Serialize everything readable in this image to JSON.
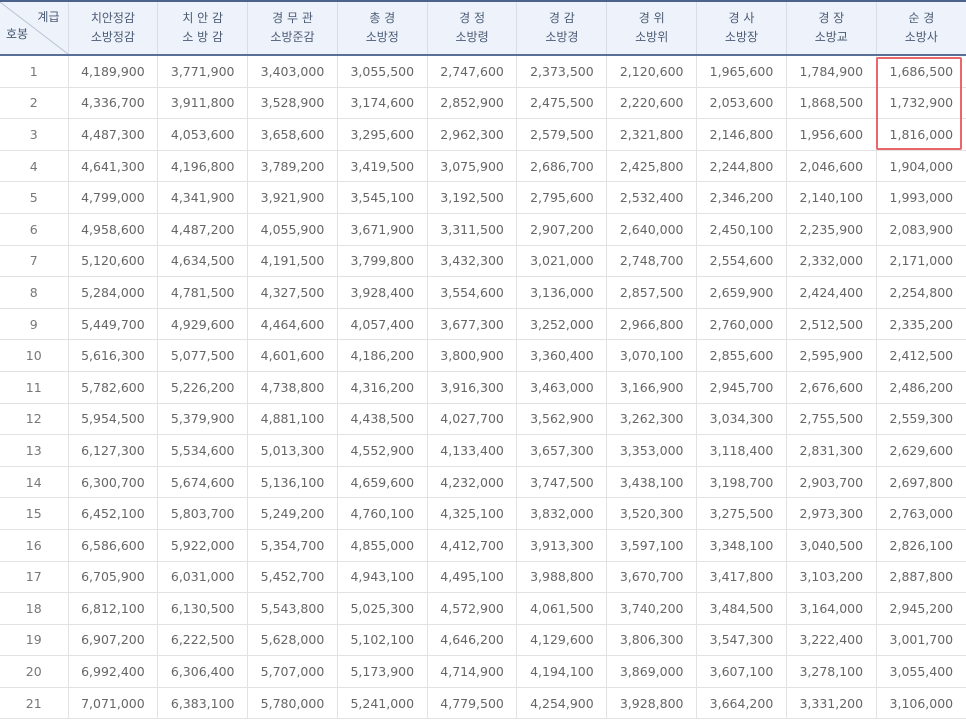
{
  "corner": {
    "top": "계급",
    "bottom": "호봉"
  },
  "columns": [
    {
      "line1": "치안정감",
      "line2": "소방정감"
    },
    {
      "line1": "치 안 감",
      "line2": "소 방 감"
    },
    {
      "line1": "경 무 관",
      "line2": "소방준감"
    },
    {
      "line1": "총 경",
      "line2": "소방정"
    },
    {
      "line1": "경 정",
      "line2": "소방령"
    },
    {
      "line1": "경 감",
      "line2": "소방경"
    },
    {
      "line1": "경 위",
      "line2": "소방위"
    },
    {
      "line1": "경 사",
      "line2": "소방장"
    },
    {
      "line1": "경 장",
      "line2": "소방교"
    },
    {
      "line1": "순 경",
      "line2": "소방사"
    }
  ],
  "rows": [
    {
      "step": "1",
      "values": [
        "4,189,900",
        "3,771,900",
        "3,403,000",
        "3,055,500",
        "2,747,600",
        "2,373,500",
        "2,120,600",
        "1,965,600",
        "1,784,900",
        "1,686,500"
      ]
    },
    {
      "step": "2",
      "values": [
        "4,336,700",
        "3,911,800",
        "3,528,900",
        "3,174,600",
        "2,852,900",
        "2,475,500",
        "2,220,600",
        "2,053,600",
        "1,868,500",
        "1,732,900"
      ]
    },
    {
      "step": "3",
      "values": [
        "4,487,300",
        "4,053,600",
        "3,658,600",
        "3,295,600",
        "2,962,300",
        "2,579,500",
        "2,321,800",
        "2,146,800",
        "1,956,600",
        "1,816,000"
      ]
    },
    {
      "step": "4",
      "values": [
        "4,641,300",
        "4,196,800",
        "3,789,200",
        "3,419,500",
        "3,075,900",
        "2,686,700",
        "2,425,800",
        "2,244,800",
        "2,046,600",
        "1,904,000"
      ]
    },
    {
      "step": "5",
      "values": [
        "4,799,000",
        "4,341,900",
        "3,921,900",
        "3,545,100",
        "3,192,500",
        "2,795,600",
        "2,532,400",
        "2,346,200",
        "2,140,100",
        "1,993,000"
      ]
    },
    {
      "step": "6",
      "values": [
        "4,958,600",
        "4,487,200",
        "4,055,900",
        "3,671,900",
        "3,311,500",
        "2,907,200",
        "2,640,000",
        "2,450,100",
        "2,235,900",
        "2,083,900"
      ]
    },
    {
      "step": "7",
      "values": [
        "5,120,600",
        "4,634,500",
        "4,191,500",
        "3,799,800",
        "3,432,300",
        "3,021,000",
        "2,748,700",
        "2,554,600",
        "2,332,000",
        "2,171,000"
      ]
    },
    {
      "step": "8",
      "values": [
        "5,284,000",
        "4,781,500",
        "4,327,500",
        "3,928,400",
        "3,554,600",
        "3,136,000",
        "2,857,500",
        "2,659,900",
        "2,424,400",
        "2,254,800"
      ]
    },
    {
      "step": "9",
      "values": [
        "5,449,700",
        "4,929,600",
        "4,464,600",
        "4,057,400",
        "3,677,300",
        "3,252,000",
        "2,966,800",
        "2,760,000",
        "2,512,500",
        "2,335,200"
      ]
    },
    {
      "step": "10",
      "values": [
        "5,616,300",
        "5,077,500",
        "4,601,600",
        "4,186,200",
        "3,800,900",
        "3,360,400",
        "3,070,100",
        "2,855,600",
        "2,595,900",
        "2,412,500"
      ]
    },
    {
      "step": "11",
      "values": [
        "5,782,600",
        "5,226,200",
        "4,738,800",
        "4,316,200",
        "3,916,300",
        "3,463,000",
        "3,166,900",
        "2,945,700",
        "2,676,600",
        "2,486,200"
      ]
    },
    {
      "step": "12",
      "values": [
        "5,954,500",
        "5,379,900",
        "4,881,100",
        "4,438,500",
        "4,027,700",
        "3,562,900",
        "3,262,300",
        "3,034,300",
        "2,755,500",
        "2,559,300"
      ]
    },
    {
      "step": "13",
      "values": [
        "6,127,300",
        "5,534,600",
        "5,013,300",
        "4,552,900",
        "4,133,400",
        "3,657,300",
        "3,353,000",
        "3,118,400",
        "2,831,300",
        "2,629,600"
      ]
    },
    {
      "step": "14",
      "values": [
        "6,300,700",
        "5,674,600",
        "5,136,100",
        "4,659,600",
        "4,232,000",
        "3,747,500",
        "3,438,100",
        "3,198,700",
        "2,903,700",
        "2,697,800"
      ]
    },
    {
      "step": "15",
      "values": [
        "6,452,100",
        "5,803,700",
        "5,249,200",
        "4,760,100",
        "4,325,100",
        "3,832,000",
        "3,520,300",
        "3,275,500",
        "2,973,300",
        "2,763,000"
      ]
    },
    {
      "step": "16",
      "values": [
        "6,586,600",
        "5,922,000",
        "5,354,700",
        "4,855,000",
        "4,412,700",
        "3,913,300",
        "3,597,100",
        "3,348,100",
        "3,040,500",
        "2,826,100"
      ]
    },
    {
      "step": "17",
      "values": [
        "6,705,900",
        "6,031,000",
        "5,452,700",
        "4,943,100",
        "4,495,100",
        "3,988,800",
        "3,670,700",
        "3,417,800",
        "3,103,200",
        "2,887,800"
      ]
    },
    {
      "step": "18",
      "values": [
        "6,812,100",
        "6,130,500",
        "5,543,800",
        "5,025,300",
        "4,572,900",
        "4,061,500",
        "3,740,200",
        "3,484,500",
        "3,164,000",
        "2,945,200"
      ]
    },
    {
      "step": "19",
      "values": [
        "6,907,200",
        "6,222,500",
        "5,628,000",
        "5,102,100",
        "4,646,200",
        "4,129,600",
        "3,806,300",
        "3,547,300",
        "3,222,400",
        "3,001,700"
      ]
    },
    {
      "step": "20",
      "values": [
        "6,992,400",
        "6,306,400",
        "5,707,000",
        "5,173,900",
        "4,714,900",
        "4,194,100",
        "3,869,000",
        "3,607,100",
        "3,278,100",
        "3,055,400"
      ]
    },
    {
      "step": "21",
      "values": [
        "7,071,000",
        "6,383,100",
        "5,780,000",
        "5,241,000",
        "4,779,500",
        "4,254,900",
        "3,928,800",
        "3,664,200",
        "3,331,200",
        "3,106,000"
      ]
    }
  ],
  "highlight": {
    "color": "#e9676b",
    "column": 10,
    "rows": [
      1,
      2,
      3
    ]
  },
  "colors": {
    "header_bg": "#eef3fb",
    "header_text": "#4a5a74",
    "header_rule": "#5a6f97",
    "cell_text": "#666666"
  }
}
